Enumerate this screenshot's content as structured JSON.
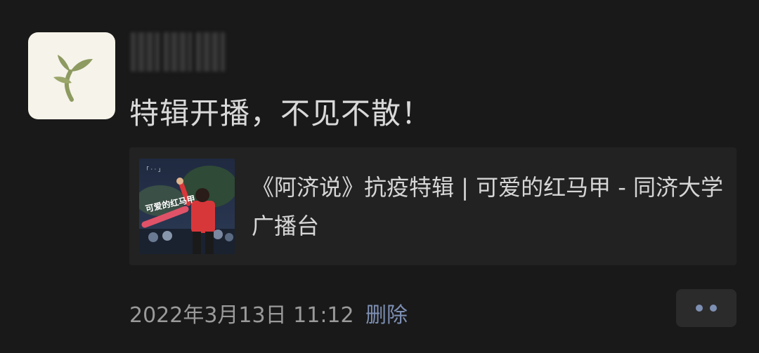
{
  "post": {
    "avatar_icon": "sprout-logo-icon",
    "text": "特辑开播，不见不散！"
  },
  "link_card": {
    "title": "《阿济说》抗疫特辑 | 可爱的红马甲 - 同济大学广播台",
    "thumbnail": {
      "top_caption": "「 ·  · 」",
      "overlay_text": "可爱的红马甲"
    }
  },
  "footer": {
    "timestamp": "2022年3月13日 11:12",
    "delete_label": "删除",
    "more_icon": "two-dots-icon"
  },
  "colors": {
    "background": "#191919",
    "text": "#d9d9d9",
    "link_blue": "#7d8fb3",
    "card": "#222222",
    "vest_red": "#d8373a"
  }
}
